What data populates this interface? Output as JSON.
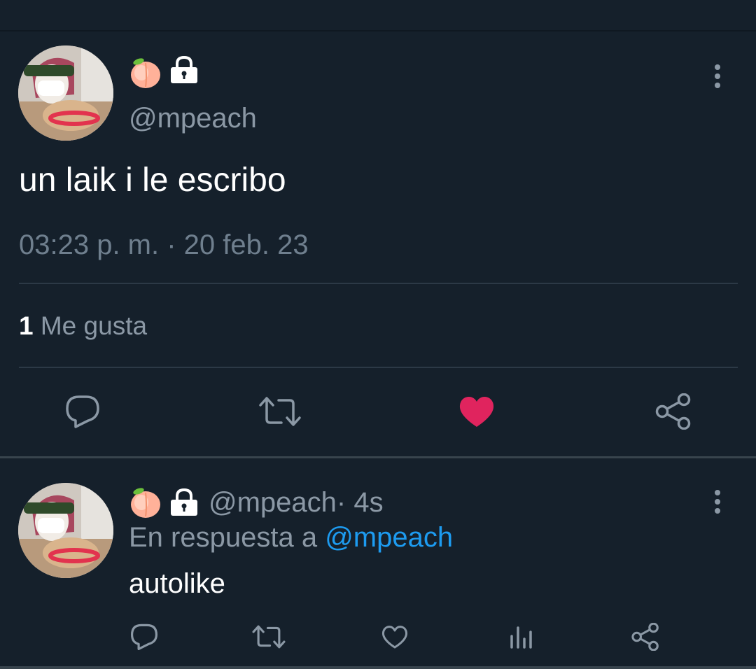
{
  "tweet": {
    "handle": "@mpeach",
    "text": "un laik i le escribo",
    "timestamp": "03:23 p. m. · 20 feb. 23",
    "likes_count": "1",
    "likes_label": "Me gusta",
    "liked": true
  },
  "reply": {
    "handle": "@mpeach",
    "time": " · 4s",
    "reply_to_prefix": "En respuesta a",
    "reply_to_mention": "@mpeach",
    "text": "autolike"
  },
  "icons": {
    "name_emoji": "peach-emoji",
    "protected": "lock-icon",
    "more": "more-vertical-icon",
    "reply": "reply-icon",
    "retweet": "retweet-icon",
    "like": "heart-icon",
    "analytics": "analytics-icon",
    "share": "share-icon"
  },
  "colors": {
    "background": "#15202b",
    "like_active": "#e0245e",
    "mention": "#1d9bf0",
    "muted_text": "#8b98a5"
  }
}
